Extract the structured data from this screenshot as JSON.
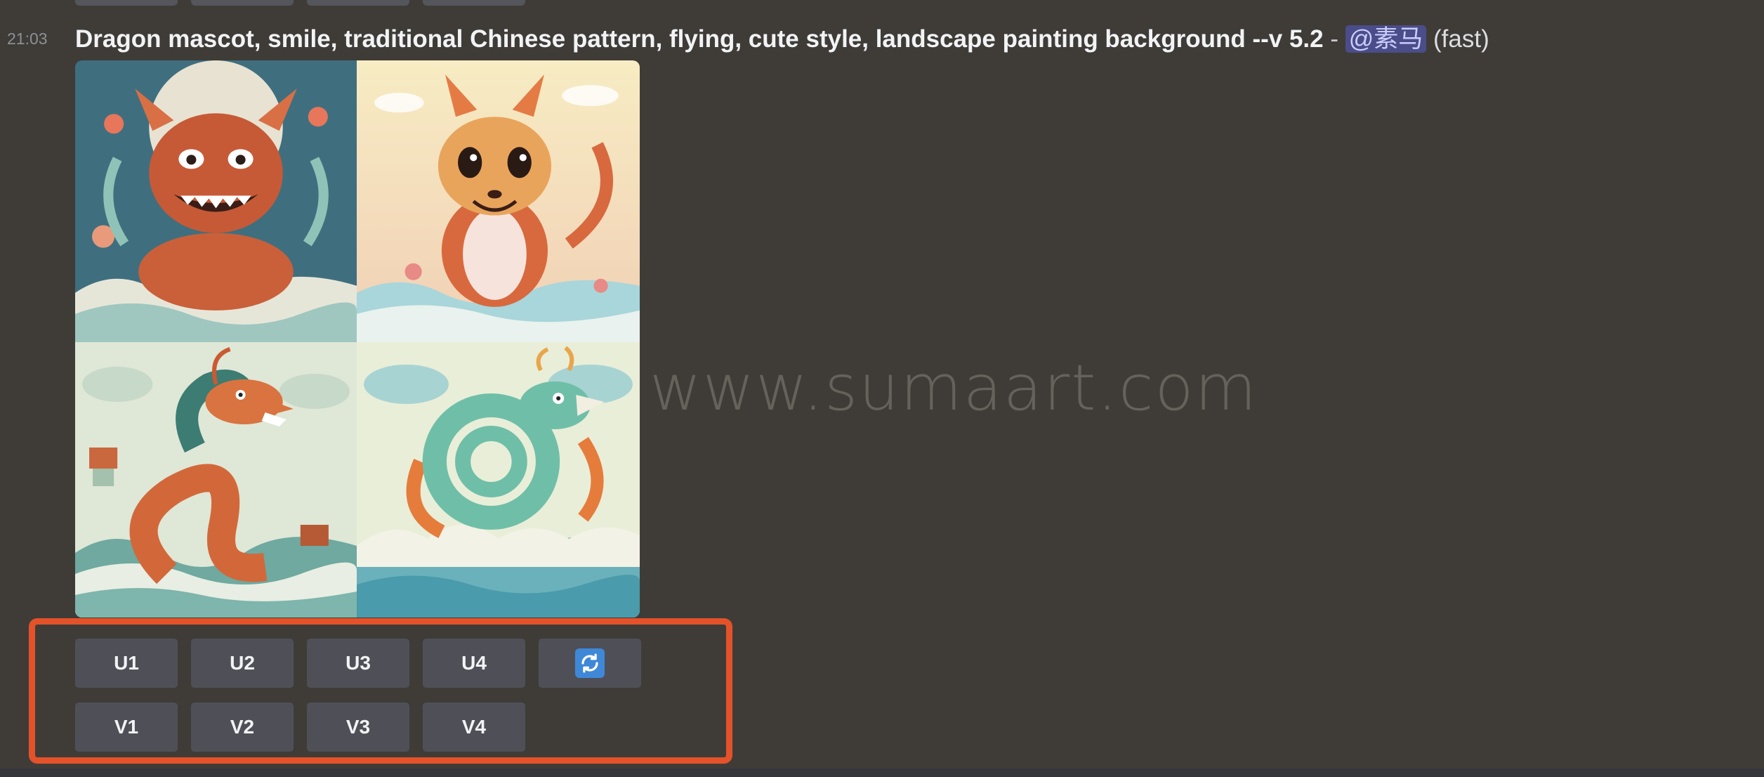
{
  "message": {
    "timestamp": "21:03",
    "prompt": "Dragon mascot, smile, traditional Chinese pattern, flying, cute style, landscape painting background --v 5.2",
    "separator": "-",
    "mention": "@素马",
    "speed": "(fast)"
  },
  "image_grid": {
    "tiles": [
      {
        "icon": "fierce-red-dragon-image"
      },
      {
        "icon": "cute-fox-dragon-image"
      },
      {
        "icon": "coiled-orange-dragon-image"
      },
      {
        "icon": "teal-dragon-waves-image"
      }
    ]
  },
  "watermark": "www.sumaart.com",
  "buttons": {
    "upscale": [
      "U1",
      "U2",
      "U3",
      "U4"
    ],
    "variation": [
      "V1",
      "V2",
      "V3",
      "V4"
    ],
    "reroll_icon": "refresh-icon"
  },
  "colors": {
    "background": "#3f3c38",
    "button": "#4f5057",
    "highlight": "#e4522a",
    "refresh": "#3f88d8",
    "mention_bg": "#4a4d8a"
  }
}
